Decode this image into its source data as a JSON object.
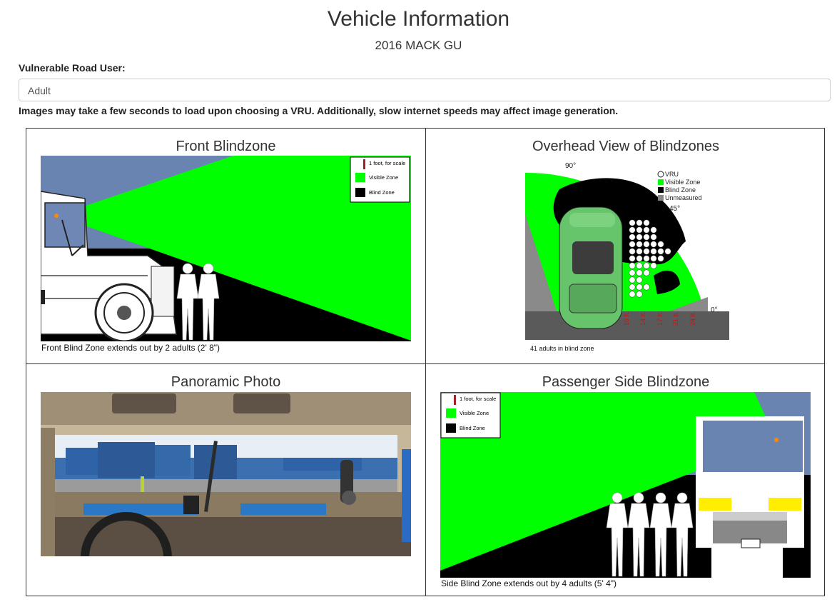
{
  "header": {
    "title": "Vehicle Information",
    "vehicle": "2016 MACK GU"
  },
  "vru": {
    "label": "Vulnerable Road User:",
    "selected": "Adult"
  },
  "notice": "Images may take a few seconds to load upon choosing a VRU. Additionally, slow internet speeds may affect image generation.",
  "panels": {
    "front": {
      "title": "Front Blindzone",
      "caption": "Front Blind Zone extends out by 2 adults (2' 8\")",
      "legend": [
        "1 foot, for scale",
        "Visible Zone",
        "Blind Zone"
      ]
    },
    "overhead": {
      "title": "Overhead View of Blindzones",
      "caption": "41 adults in blind zone",
      "legend": [
        "VRU",
        "Visible Zone",
        "Blind Zone",
        "Unmeasured"
      ],
      "angles": [
        "90°",
        "45°",
        "0°"
      ],
      "distances": [
        "10 ft.",
        "14 ft.",
        "17 ft.",
        "21 ft.",
        "24 ft."
      ]
    },
    "panoramic": {
      "title": "Panoramic Photo"
    },
    "side": {
      "title": "Passenger Side Blindzone",
      "caption": "Side Blind Zone extends out by 4 adults (5' 4\")",
      "legend": [
        "1 foot, for scale",
        "Visible Zone",
        "Blind Zone"
      ]
    }
  },
  "colors": {
    "visible": "#00ff00",
    "blind": "#000000",
    "sky": "#6a84b2",
    "unmeasured": "#888888"
  }
}
